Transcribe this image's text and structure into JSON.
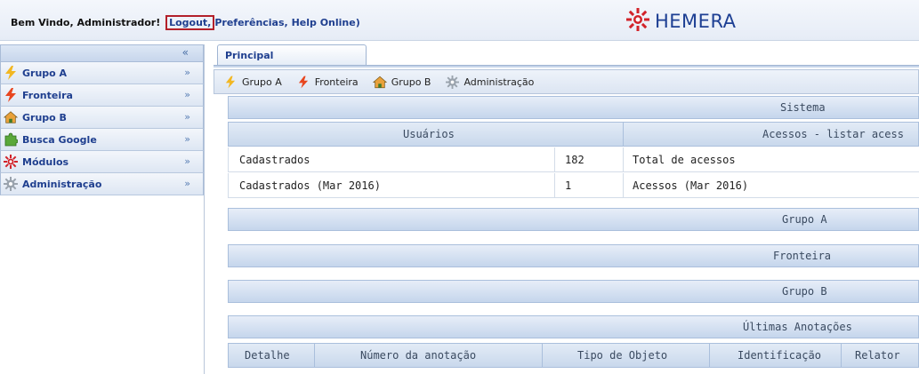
{
  "header": {
    "welcome": "Bem Vindo, Administrador!",
    "logout": "Logout,",
    "preferences": "Preferências,",
    "help": "Help Online)",
    "logo_text": "HEMERA"
  },
  "sidebar": {
    "collapse": "«",
    "items": [
      {
        "label": "Grupo A",
        "icon": "lightning-icon",
        "arrow": "»"
      },
      {
        "label": "Fronteira",
        "icon": "lightning-icon",
        "arrow": "»"
      },
      {
        "label": "Grupo B",
        "icon": "house-icon",
        "arrow": "»"
      },
      {
        "label": "Busca Google",
        "icon": "puzzle-icon",
        "arrow": "»"
      },
      {
        "label": "Módulos",
        "icon": "sun-gear-icon",
        "arrow": "»"
      },
      {
        "label": "Administração",
        "icon": "gear-icon",
        "arrow": "»"
      }
    ]
  },
  "main": {
    "tab": "Principal",
    "toolbar": [
      "Grupo A",
      "Fronteira",
      "Grupo B",
      "Administração"
    ],
    "sistema": "Sistema",
    "usuarios_header": "Usuários",
    "acessos_header": "Acessos - listar acess",
    "rows": [
      {
        "label": "Cadastrados",
        "value": "182",
        "acc_label": "Total de acessos"
      },
      {
        "label": "Cadastrados (Mar 2016)",
        "value": "1",
        "acc_label": "Acessos (Mar 2016)"
      }
    ],
    "grupo_a": "Grupo A",
    "fronteira": "Fronteira",
    "grupo_b": "Grupo B",
    "ultimas": "Últimas Anotações",
    "anotacoes_cols": [
      "Detalhe",
      "Número da anotação",
      "Tipo de Objeto",
      "Identificação",
      "Relator"
    ]
  },
  "colors": {
    "accent": "#1f3f8f",
    "logout_highlight": "#b3202a",
    "logo_red": "#d2232a"
  }
}
